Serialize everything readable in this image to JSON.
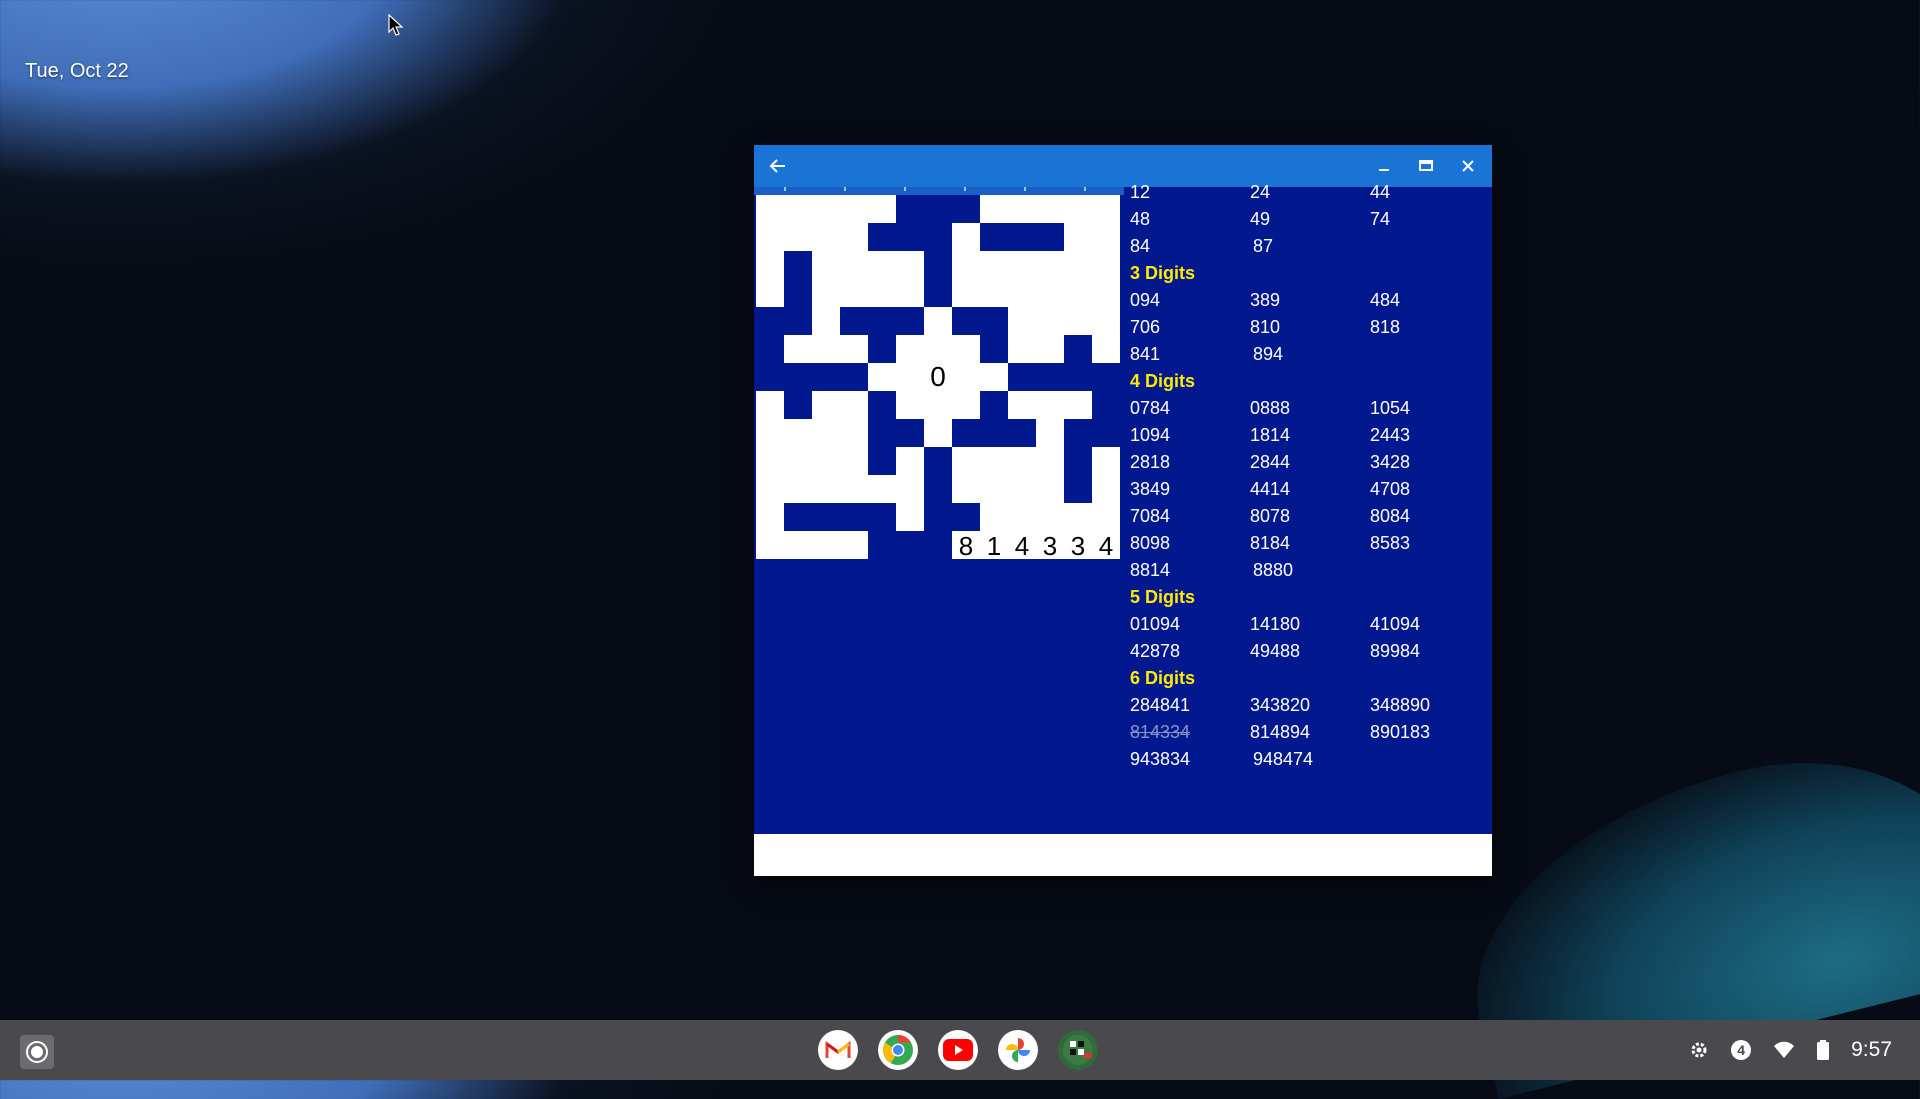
{
  "desktop": {
    "date": "Tue, Oct 22"
  },
  "window": {
    "back_icon": "arrow-left-icon",
    "minimize_icon": "minimize-icon",
    "maximize_icon": "maximize-icon",
    "close_icon": "close-icon"
  },
  "puzzle": {
    "center_number": "0",
    "entered_word": [
      "8",
      "1",
      "4",
      "3",
      "3",
      "4"
    ]
  },
  "word_list": {
    "two_digits": [
      "12",
      "24",
      "44",
      "48",
      "49",
      "74",
      "84",
      "87"
    ],
    "sections": [
      {
        "header": "3 Digits",
        "items": [
          "094",
          "389",
          "484",
          "706",
          "810",
          "818",
          "841",
          "894"
        ]
      },
      {
        "header": "4 Digits",
        "items": [
          "0784",
          "0888",
          "1054",
          "1094",
          "1814",
          "2443",
          "2818",
          "2844",
          "3428",
          "3849",
          "4414",
          "4708",
          "7084",
          "8078",
          "8084",
          "8098",
          "8184",
          "8583",
          "8814",
          "8880"
        ]
      },
      {
        "header": "5 Digits",
        "items": [
          "01094",
          "14180",
          "41094",
          "42878",
          "49488",
          "89984"
        ]
      },
      {
        "header": "6 Digits",
        "items": [
          "284841",
          "343820",
          "348890",
          "814334",
          "814894",
          "890183",
          "943834",
          "948474"
        ],
        "completed": [
          "814334"
        ]
      }
    ]
  },
  "shelf": {
    "apps": [
      {
        "name": "Gmail",
        "icon": "gmail-icon"
      },
      {
        "name": "Chrome",
        "icon": "chrome-icon"
      },
      {
        "name": "YouTube",
        "icon": "youtube-icon"
      },
      {
        "name": "Photos",
        "icon": "photos-icon"
      },
      {
        "name": "Fill-In Numbers",
        "icon": "fillin-app-icon"
      }
    ],
    "notification_count": "4",
    "time": "9:57"
  }
}
